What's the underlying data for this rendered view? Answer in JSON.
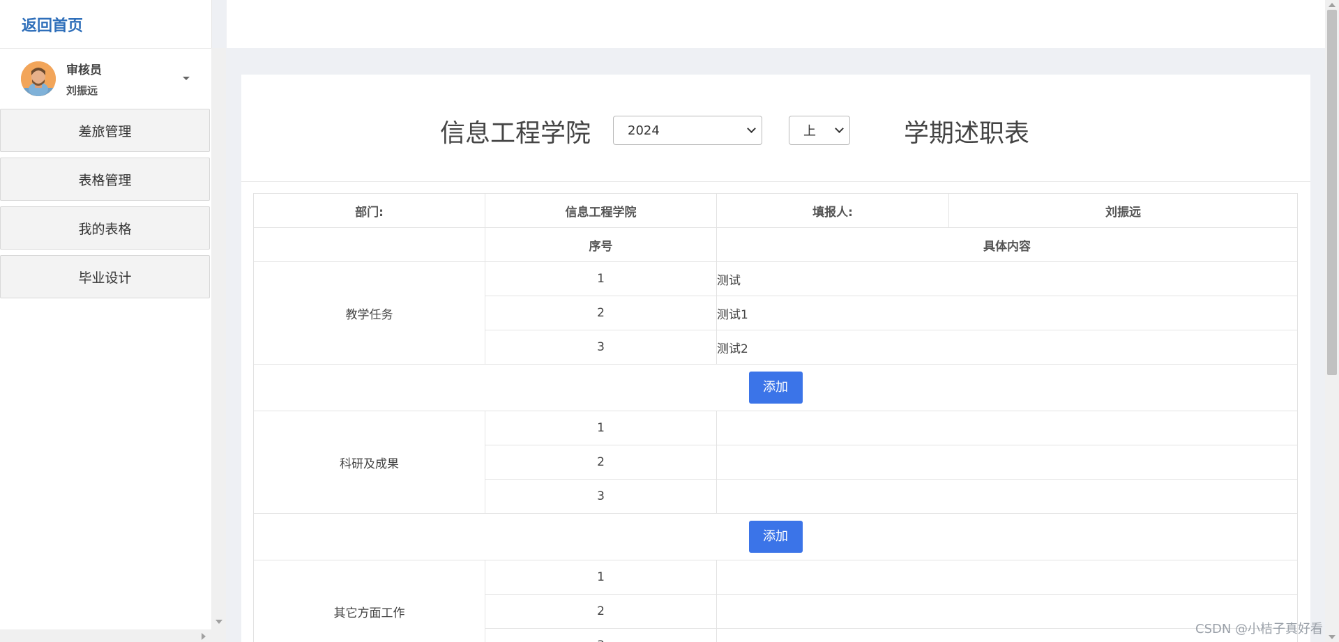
{
  "header": {
    "home_link": "返回首页"
  },
  "user": {
    "role": "审核员",
    "name": "刘振远"
  },
  "sidebar": {
    "items": [
      {
        "label": "差旅管理"
      },
      {
        "label": "表格管理"
      },
      {
        "label": "我的表格"
      },
      {
        "label": "毕业设计"
      }
    ]
  },
  "form": {
    "title_main": "信息工程学院",
    "title_tail": "学期述职表",
    "year_value": "2024",
    "term_value": "上"
  },
  "table": {
    "dept_label": "部门:",
    "dept_value": "信息工程学院",
    "filler_label": "填报人:",
    "filler_value": "刘振远",
    "col_seq": "序号",
    "col_content": "具体内容",
    "add_label": "添加",
    "sections": [
      {
        "name": "教学任务",
        "rows": [
          {
            "seq": "1",
            "content": "测试"
          },
          {
            "seq": "2",
            "content": "测试1"
          },
          {
            "seq": "3",
            "content": "测试2"
          }
        ]
      },
      {
        "name": "科研及成果",
        "rows": [
          {
            "seq": "1",
            "content": ""
          },
          {
            "seq": "2",
            "content": ""
          },
          {
            "seq": "3",
            "content": ""
          }
        ]
      },
      {
        "name": "其它方面工作",
        "rows": [
          {
            "seq": "1",
            "content": ""
          },
          {
            "seq": "2",
            "content": ""
          },
          {
            "seq": "3",
            "content": ""
          }
        ]
      }
    ]
  },
  "watermark": "CSDN @小桔子真好看"
}
